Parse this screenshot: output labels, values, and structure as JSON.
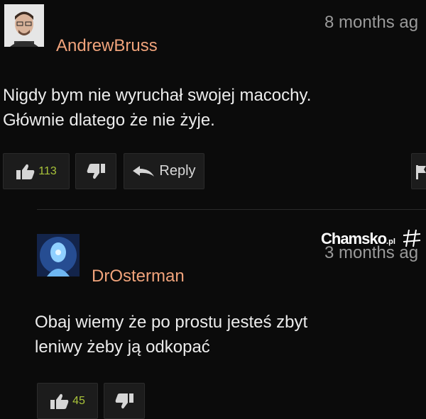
{
  "comments": [
    {
      "username": "AndrewBruss",
      "time": "8 months ag",
      "text_line1": "Nigdy bym nie wyruchał swojej macochy.",
      "text_line2": "Głównie dlatego że nie żyje.",
      "likes": "113",
      "reply_label": "Reply"
    },
    {
      "username": "DrOsterman",
      "time": "3 months ag",
      "text_line1": "Obaj wiemy że po prostu jesteś zbyt",
      "text_line2": "leniwy żeby ją odkopać",
      "likes": "45"
    }
  ],
  "watermark": {
    "brand": "Chamsko",
    "suffix": ".pl"
  },
  "colors": {
    "username": "#f0a37b",
    "count": "#a9c33a",
    "background": "#0b0b0b"
  }
}
